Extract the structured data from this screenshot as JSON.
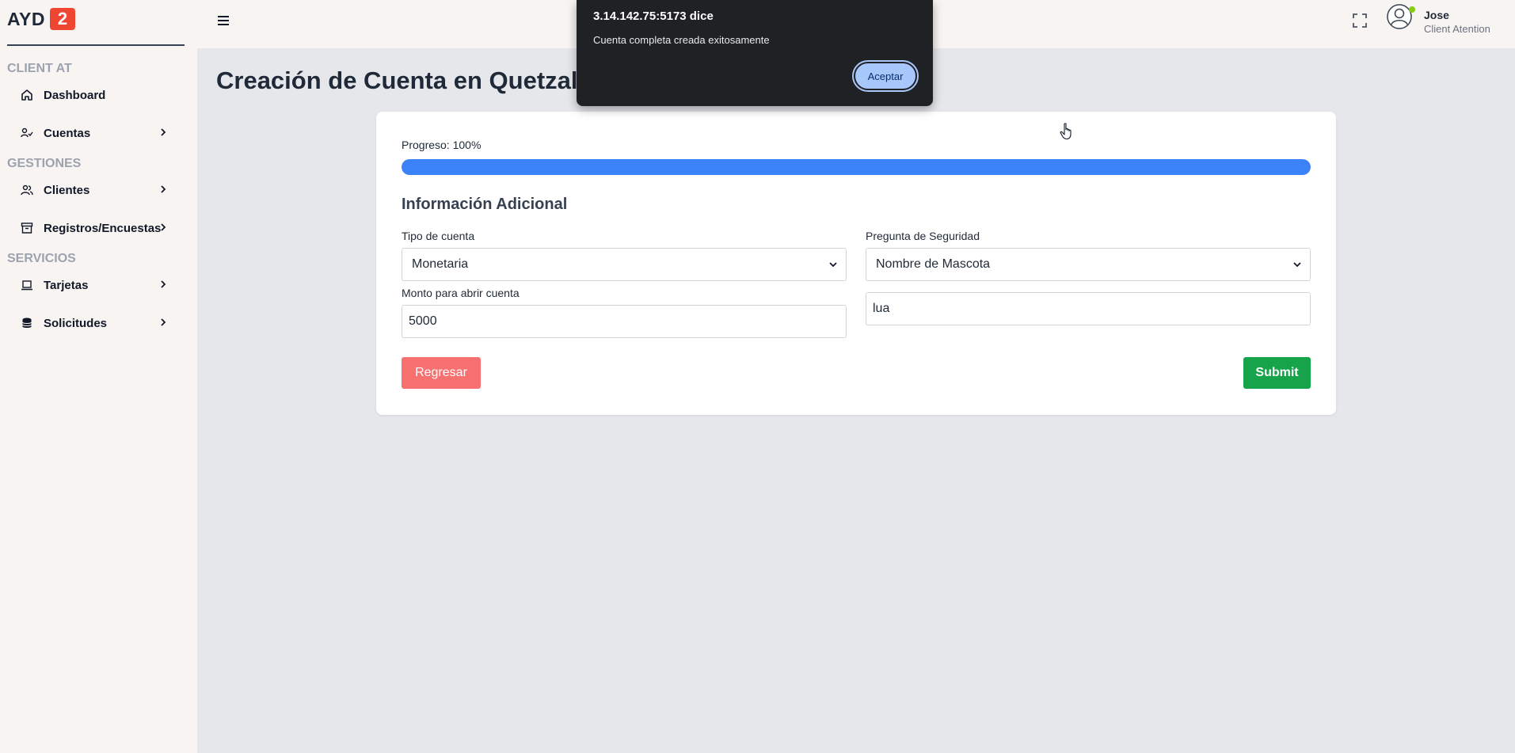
{
  "brand": {
    "name": "AYD",
    "badge": "2",
    "badge_color": "#ef4631"
  },
  "sidebar": {
    "sections": [
      {
        "title": "CLIENT AT"
      },
      {
        "title": "GESTIONES"
      },
      {
        "title": "SERVICIOS"
      }
    ],
    "items": [
      {
        "label": "Dashboard",
        "icon": "home-icon",
        "has_submenu": false
      },
      {
        "label": "Cuentas",
        "icon": "user-check-icon",
        "has_submenu": true
      },
      {
        "label": "Clientes",
        "icon": "users-icon",
        "has_submenu": true
      },
      {
        "label": "Registros/Encuestas",
        "icon": "archive-icon",
        "has_submenu": true
      },
      {
        "label": "Tarjetas",
        "icon": "laptop-icon",
        "has_submenu": true
      },
      {
        "label": "Solicitudes",
        "icon": "database-icon",
        "has_submenu": true
      }
    ]
  },
  "header": {
    "user": {
      "name": "Jose",
      "role": "Client Atention",
      "status": "online"
    }
  },
  "main": {
    "title": "Creación de Cuenta en Quetzal",
    "progress": {
      "label": "Progreso: 100%",
      "value": 100
    },
    "section_title": "Información Adicional",
    "form": {
      "account_type": {
        "label": "Tipo de cuenta",
        "value": "Monetaria"
      },
      "security_question": {
        "label": "Pregunta de Seguridad",
        "value": "Nombre de Mascota"
      },
      "opening_amount": {
        "label": "Monto para abrir cuenta",
        "value": "5000"
      },
      "security_answer": {
        "value": "lua"
      }
    },
    "buttons": {
      "back": "Regresar",
      "submit": "Submit"
    }
  },
  "dialog": {
    "title": "3.14.142.75:5173 dice",
    "message": "Cuenta completa creada exitosamente",
    "button": "Aceptar"
  },
  "colors": {
    "accent_blue": "#3b82f6",
    "submit_green": "#16a34a",
    "back_red": "#f87171"
  }
}
